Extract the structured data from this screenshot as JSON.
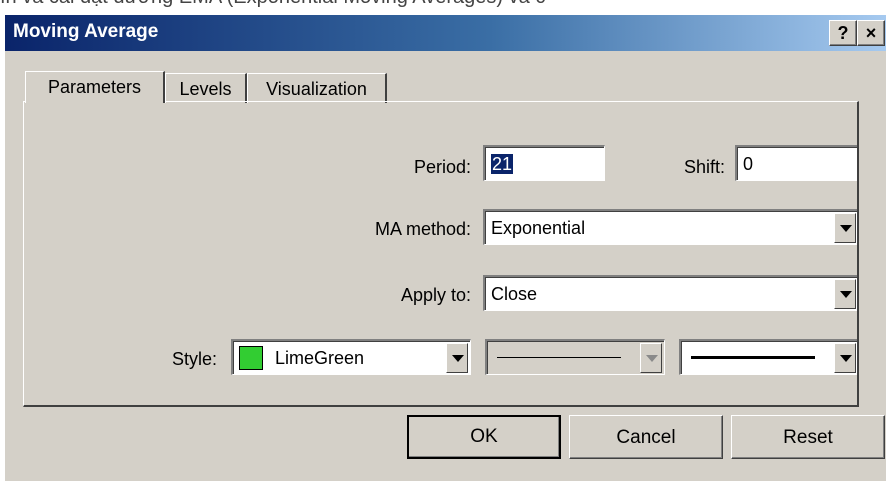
{
  "background_text": "ìn và cài đặt đường EMA (Exponential Moving Averages) và c",
  "window": {
    "title": "Moving Average",
    "help_button": "?",
    "close_button": "×"
  },
  "tabs": [
    {
      "label": "Parameters",
      "active": true
    },
    {
      "label": "Levels",
      "active": false
    },
    {
      "label": "Visualization",
      "active": false
    }
  ],
  "params": {
    "period_label": "Period:",
    "period_value": "21",
    "shift_label": "Shift:",
    "shift_value": "0",
    "ma_method_label": "MA method:",
    "ma_method_value": "Exponential",
    "apply_to_label": "Apply to:",
    "apply_to_value": "Close",
    "style_label": "Style:",
    "color_name": "LimeGreen",
    "color_hex": "#32cd32"
  },
  "buttons": {
    "ok": "OK",
    "cancel": "Cancel",
    "reset": "Reset"
  }
}
